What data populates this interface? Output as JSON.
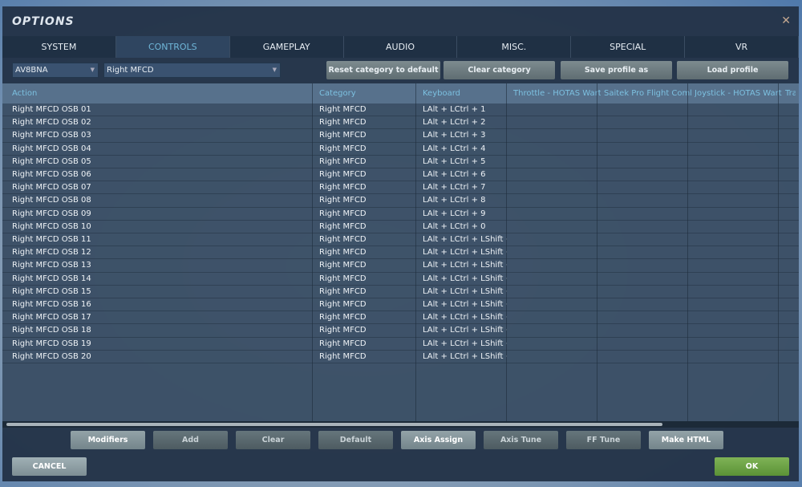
{
  "window": {
    "title": "OPTIONS",
    "close_icon": "close-icon"
  },
  "tabs": [
    {
      "label": "SYSTEM"
    },
    {
      "label": "CONTROLS",
      "active": true
    },
    {
      "label": "GAMEPLAY"
    },
    {
      "label": "AUDIO"
    },
    {
      "label": "MISC."
    },
    {
      "label": "SPECIAL"
    },
    {
      "label": "VR"
    }
  ],
  "toolbar": {
    "aircraft": "AV8BNA",
    "category": "Right MFCD",
    "reset": "Reset category to default",
    "clear": "Clear category",
    "save": "Save profile as",
    "load": "Load profile"
  },
  "columns": [
    "Action",
    "Category",
    "Keyboard",
    "Throttle - HOTAS Wart",
    "Saitek Pro Flight Comb",
    "Joystick - HOTAS Wartl",
    "Trac"
  ],
  "rows": [
    [
      "Right MFCD OSB 01",
      "Right MFCD",
      "LAlt + LCtrl + 1"
    ],
    [
      "Right MFCD OSB 02",
      "Right MFCD",
      "LAlt + LCtrl + 2"
    ],
    [
      "Right MFCD OSB 03",
      "Right MFCD",
      "LAlt + LCtrl + 3"
    ],
    [
      "Right MFCD OSB 04",
      "Right MFCD",
      "LAlt + LCtrl + 4"
    ],
    [
      "Right MFCD OSB 05",
      "Right MFCD",
      "LAlt + LCtrl + 5"
    ],
    [
      "Right MFCD OSB 06",
      "Right MFCD",
      "LAlt + LCtrl + 6"
    ],
    [
      "Right MFCD OSB 07",
      "Right MFCD",
      "LAlt + LCtrl + 7"
    ],
    [
      "Right MFCD OSB 08",
      "Right MFCD",
      "LAlt + LCtrl + 8"
    ],
    [
      "Right MFCD OSB 09",
      "Right MFCD",
      "LAlt + LCtrl + 9"
    ],
    [
      "Right MFCD OSB 10",
      "Right MFCD",
      "LAlt + LCtrl + 0"
    ],
    [
      "Right MFCD OSB 11",
      "Right MFCD",
      "LAlt + LCtrl + LShift +"
    ],
    [
      "Right MFCD OSB 12",
      "Right MFCD",
      "LAlt + LCtrl + LShift +"
    ],
    [
      "Right MFCD OSB 13",
      "Right MFCD",
      "LAlt + LCtrl + LShift +"
    ],
    [
      "Right MFCD OSB 14",
      "Right MFCD",
      "LAlt + LCtrl + LShift +"
    ],
    [
      "Right MFCD OSB 15",
      "Right MFCD",
      "LAlt + LCtrl + LShift +"
    ],
    [
      "Right MFCD OSB 16",
      "Right MFCD",
      "LAlt + LCtrl + LShift +"
    ],
    [
      "Right MFCD OSB 17",
      "Right MFCD",
      "LAlt + LCtrl + LShift +"
    ],
    [
      "Right MFCD OSB 18",
      "Right MFCD",
      "LAlt + LCtrl + LShift +"
    ],
    [
      "Right MFCD OSB 19",
      "Right MFCD",
      "LAlt + LCtrl + LShift +"
    ],
    [
      "Right MFCD OSB 20",
      "Right MFCD",
      "LAlt + LCtrl + LShift +"
    ]
  ],
  "bottom_buttons": [
    {
      "label": "Modifiers",
      "enabled": true
    },
    {
      "label": "Add",
      "enabled": false
    },
    {
      "label": "Clear",
      "enabled": false
    },
    {
      "label": "Default",
      "enabled": false
    },
    {
      "label": "Axis Assign",
      "enabled": true
    },
    {
      "label": "Axis Tune",
      "enabled": false
    },
    {
      "label": "FF Tune",
      "enabled": false
    },
    {
      "label": "Make HTML",
      "enabled": true
    }
  ],
  "footer": {
    "cancel": "CANCEL",
    "ok": "OK"
  },
  "colors": {
    "accent": "#6fb6d8",
    "ok": "#5a9236",
    "panel": "#243448"
  }
}
